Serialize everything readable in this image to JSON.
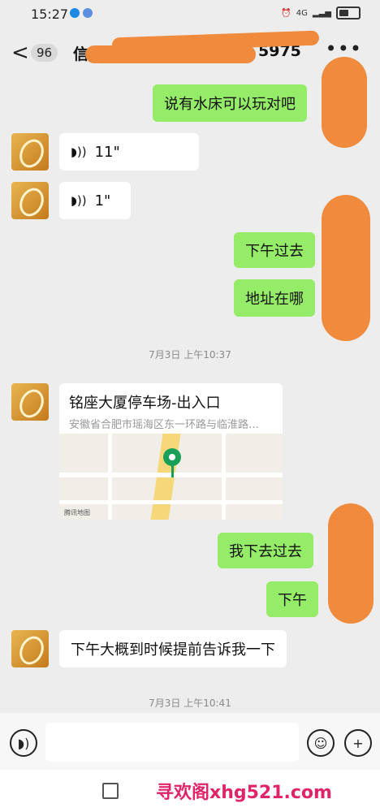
{
  "status_bar": {
    "time": "15:27",
    "network": "4G"
  },
  "header": {
    "back_icon": "chevron-left-icon",
    "unread_count": "96",
    "title_start": "信",
    "title_end": "5975",
    "more_icon": "more-dots-icon"
  },
  "messages": [
    {
      "side": "right",
      "type": "text",
      "text": "说有水床可以玩对吧"
    },
    {
      "side": "left",
      "type": "voice",
      "duration": "11\""
    },
    {
      "side": "left",
      "type": "voice",
      "duration": "1\""
    },
    {
      "side": "right",
      "type": "text",
      "text": "下午过去"
    },
    {
      "side": "right",
      "type": "text",
      "text": "地址在哪"
    },
    {
      "side": "system",
      "type": "timestamp",
      "text": "7月3日 上午10:37"
    },
    {
      "side": "left",
      "type": "location",
      "title": "铭座大厦停车场-出入口",
      "address": "安徽省合肥市瑶海区东一环路与临淮路…",
      "map_brand": "腾讯地图"
    },
    {
      "side": "right",
      "type": "text",
      "text": "我下去过去"
    },
    {
      "side": "right",
      "type": "text",
      "text": "下午"
    },
    {
      "side": "left",
      "type": "text",
      "text": "下午大概到时候提前告诉我一下"
    },
    {
      "side": "system",
      "type": "timestamp",
      "text": "7月3日 上午10:41"
    }
  ],
  "input_bar": {
    "voice_icon": "voice-icon",
    "emoji_icon": "emoji-icon",
    "add_icon": "plus-icon"
  },
  "watermark": "寻欢阁xhg521.com",
  "colors": {
    "background": "#ededed",
    "sent_bubble": "#95ec69",
    "received_bubble": "#ffffff",
    "scribble": "#f08a3c",
    "watermark": "#e0246a"
  }
}
